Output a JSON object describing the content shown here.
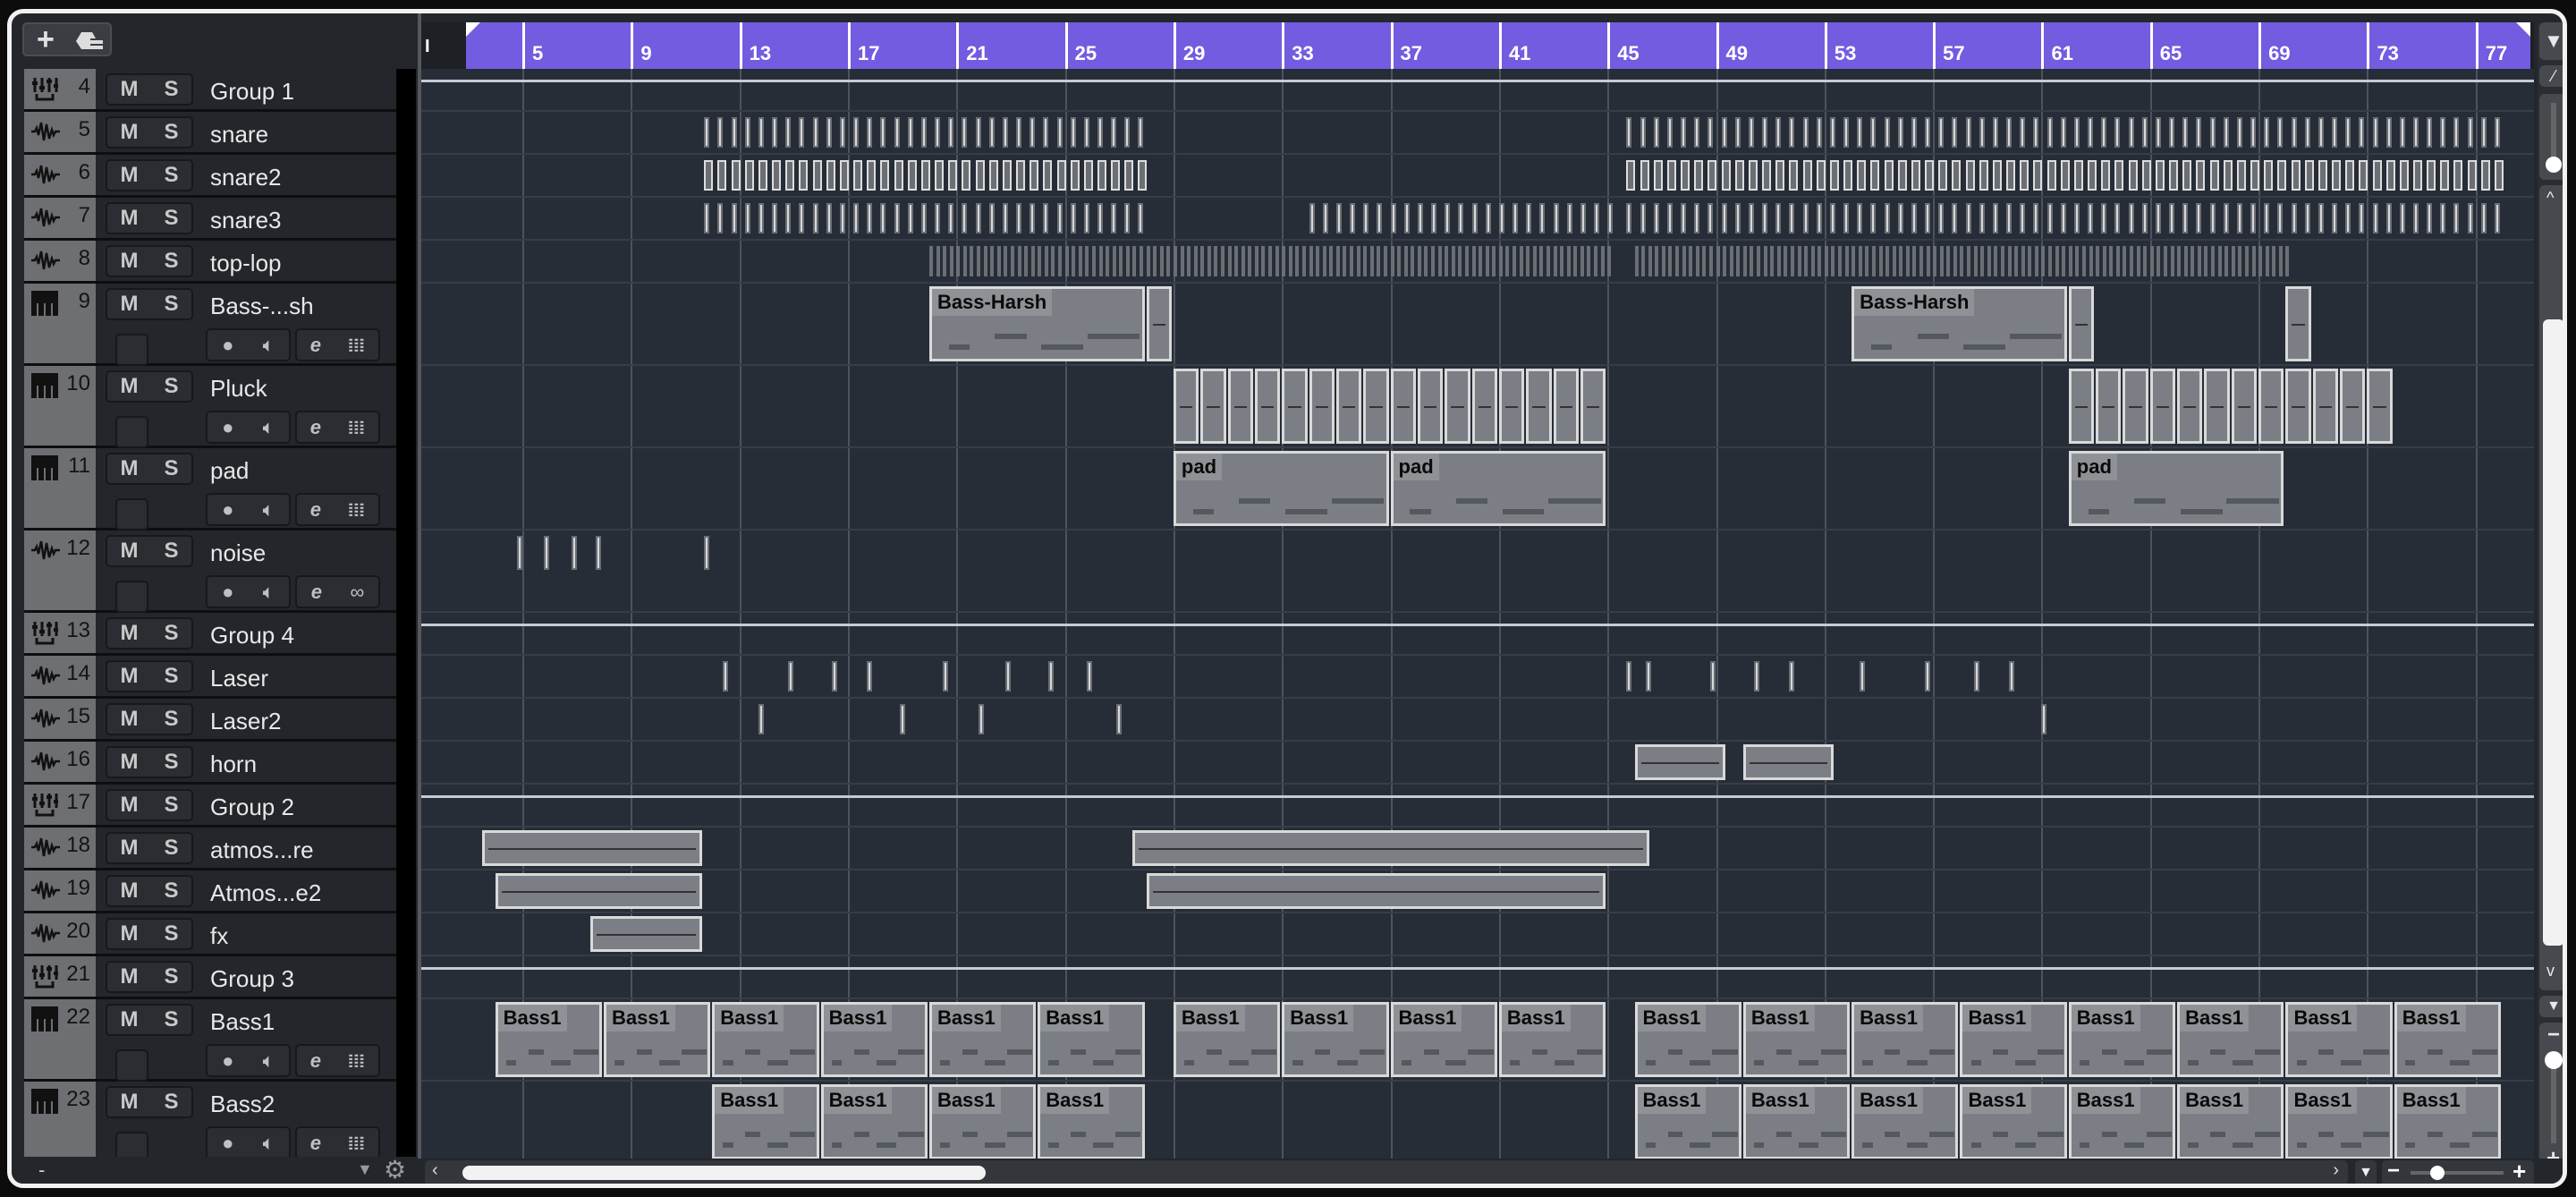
{
  "toolbar": {
    "add_track_icon": "plus-icon",
    "folder_icon": "track-folder-icon"
  },
  "ruler": {
    "start_marker": "I",
    "bars": [
      5,
      9,
      13,
      17,
      21,
      25,
      29,
      33,
      37,
      41,
      45,
      49,
      53,
      57,
      61,
      65,
      69,
      73,
      77
    ]
  },
  "labels": {
    "mute": "M",
    "solo": "S",
    "left_footer": "-"
  },
  "tracks": [
    {
      "num": "4",
      "name": "Group 1",
      "type": "group"
    },
    {
      "num": "5",
      "name": "snare",
      "type": "audio",
      "hits": [
        {
          "from": 11.7,
          "to": 28,
          "step": 0.5
        },
        {
          "from": 45.7,
          "to": 78,
          "step": 0.5
        }
      ]
    },
    {
      "num": "6",
      "name": "snare2",
      "type": "audio",
      "hits": [
        {
          "from": 11.7,
          "to": 28,
          "step": 0.5
        },
        {
          "from": 45.7,
          "to": 78,
          "step": 0.5
        }
      ],
      "hollow": true
    },
    {
      "num": "7",
      "name": "snare3",
      "type": "audio",
      "hits": [
        {
          "from": 11.7,
          "to": 28,
          "step": 0.5
        },
        {
          "from": 34,
          "to": 45,
          "step": 0.5
        },
        {
          "from": 45.7,
          "to": 78,
          "step": 0.5
        }
      ]
    },
    {
      "num": "8",
      "name": "top-lop",
      "type": "audio",
      "hits": [
        {
          "from": 20,
          "to": 45,
          "step": 0.25
        },
        {
          "from": 46,
          "to": 70,
          "step": 0.25
        }
      ]
    },
    {
      "num": "9",
      "name": "Bass-...sh",
      "type": "instrument",
      "double": true,
      "clips": [
        {
          "start": 20,
          "len": 8,
          "label": "Bass-Harsh"
        },
        {
          "start": 28,
          "len": 1
        },
        {
          "start": 54,
          "len": 8,
          "label": "Bass-Harsh"
        },
        {
          "start": 62,
          "len": 1
        },
        {
          "start": 70,
          "len": 1
        }
      ]
    },
    {
      "num": "10",
      "name": "Pluck",
      "type": "instrument",
      "double": true,
      "repeat": [
        {
          "start": 29,
          "count": 16,
          "len": 1
        },
        {
          "start": 62,
          "count": 12,
          "len": 1
        }
      ]
    },
    {
      "num": "11",
      "name": "pad",
      "type": "instrument",
      "double": true,
      "clips": [
        {
          "start": 29,
          "len": 8,
          "label": "pad"
        },
        {
          "start": 37,
          "len": 8,
          "label": "pad"
        },
        {
          "start": 62,
          "len": 8,
          "label": "pad"
        }
      ]
    },
    {
      "num": "12",
      "name": "noise",
      "type": "audio",
      "double": true,
      "loop": true,
      "marks": [
        4.8,
        5.8,
        6.8,
        7.7,
        11.7
      ]
    },
    {
      "num": "13",
      "name": "Group 4",
      "type": "group"
    },
    {
      "num": "14",
      "name": "Laser",
      "type": "audio",
      "marks": [
        12.4,
        14.8,
        16.4,
        17.7,
        20.5,
        22.8,
        24.4,
        25.8,
        45.7,
        46.4,
        48.8,
        50.4,
        51.7,
        54.3,
        56.7,
        58.5,
        59.8
      ]
    },
    {
      "num": "15",
      "name": "Laser2",
      "type": "audio",
      "marks": [
        13.7,
        18.9,
        21.8,
        26.9,
        61
      ]
    },
    {
      "num": "16",
      "name": "horn",
      "type": "audio",
      "clips": [
        {
          "start": 46,
          "len": 3.4
        },
        {
          "start": 50,
          "len": 3.4
        }
      ]
    },
    {
      "num": "17",
      "name": "Group 2",
      "type": "group"
    },
    {
      "num": "18",
      "name": "atmos...re",
      "type": "audio",
      "clips": [
        {
          "start": 3.5,
          "len": 8.2
        },
        {
          "start": 27.5,
          "len": 19.1
        }
      ]
    },
    {
      "num": "19",
      "name": "Atmos...e2",
      "type": "audio",
      "clips": [
        {
          "start": 4,
          "len": 7.7
        },
        {
          "start": 28,
          "len": 17
        }
      ]
    },
    {
      "num": "20",
      "name": "fx",
      "type": "audio",
      "clips": [
        {
          "start": 7.5,
          "len": 4.2
        }
      ]
    },
    {
      "num": "21",
      "name": "Group 3",
      "type": "group"
    },
    {
      "num": "22",
      "name": "Bass1",
      "type": "instrument",
      "double": true,
      "repeat": [
        {
          "start": 4,
          "count": 6,
          "len": 4,
          "label": "Bass1"
        },
        {
          "start": 29,
          "count": 4,
          "len": 4,
          "label": "Bass1"
        },
        {
          "start": 46,
          "count": 8,
          "len": 4,
          "label": "Bass1"
        }
      ]
    },
    {
      "num": "23",
      "name": "Bass2",
      "type": "instrument",
      "double": true,
      "repeat": [
        {
          "start": 12,
          "count": 4,
          "len": 4,
          "label": "Bass1"
        },
        {
          "start": 46,
          "count": 8,
          "len": 4,
          "label": "Bass1"
        }
      ]
    }
  ],
  "colors": {
    "ruler": "#735ce0",
    "arrange_bg": "#262d37",
    "clip": "#7b7f85"
  }
}
